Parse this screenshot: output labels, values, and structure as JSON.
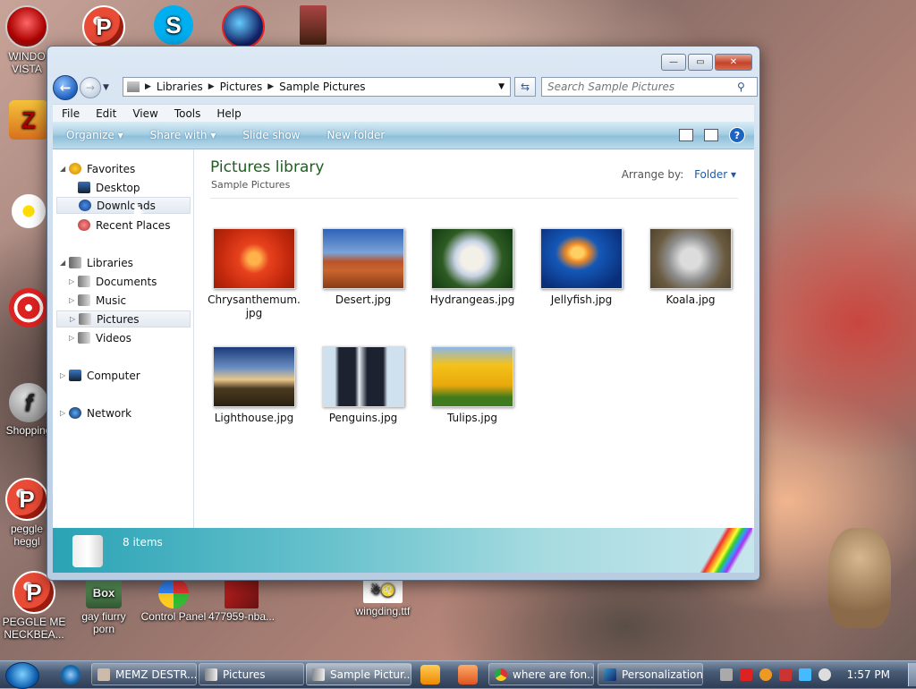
{
  "desktop": {
    "icons": [
      {
        "label": "WINDO\nVISTA",
        "name": "windows-vista"
      },
      {
        "label": "Shopping",
        "name": "shopping"
      },
      {
        "label": "peggle\nheggl",
        "name": "peggle-heggle"
      },
      {
        "label": "PEGGLE ME\nNECKBEA...",
        "name": "peggle-me"
      },
      {
        "label": "gay fiurry\nporn",
        "name": "box-shortcut"
      },
      {
        "label": "Control Panel",
        "name": "control-panel"
      },
      {
        "label": "477959-nba...",
        "name": "nba-image"
      },
      {
        "label": "wingding.ttf",
        "name": "wingding-font"
      }
    ]
  },
  "window": {
    "breadcrumb": [
      "Libraries",
      "Pictures",
      "Sample Pictures"
    ],
    "search_placeholder": "Search Sample Pictures",
    "menu": [
      "File",
      "Edit",
      "View",
      "Tools",
      "Help"
    ],
    "commands": [
      "Organize ▾",
      "Share with ▾",
      "Slide show",
      "New folder"
    ],
    "nav": {
      "favorites": "Favorites",
      "desktop": "Desktop",
      "downloads": "Downloads",
      "recent": "Recent Places",
      "libraries": "Libraries",
      "documents": "Documents",
      "music": "Music",
      "pictures": "Pictures",
      "videos": "Videos",
      "computer": "Computer",
      "network": "Network"
    },
    "content": {
      "title": "Pictures library",
      "subtitle": "Sample Pictures",
      "arrange_label": "Arrange by:",
      "arrange_value": "Folder ▾",
      "files": [
        {
          "line1": "Chrysanthemum.",
          "line2": "jpg"
        },
        {
          "line1": "Desert.jpg",
          "line2": ""
        },
        {
          "line1": "Hydrangeas.jpg",
          "line2": ""
        },
        {
          "line1": "Jellyfish.jpg",
          "line2": ""
        },
        {
          "line1": "Koala.jpg",
          "line2": ""
        },
        {
          "line1": "Lighthouse.jpg",
          "line2": ""
        },
        {
          "line1": "Penguins.jpg",
          "line2": ""
        },
        {
          "line1": "Tulips.jpg",
          "line2": ""
        }
      ]
    },
    "status": "8 items"
  },
  "taskbar": {
    "buttons": [
      {
        "label": "MEMZ DESTR...",
        "name": "memz"
      },
      {
        "label": "Pictures",
        "name": "pictures"
      },
      {
        "label": "Sample Pictur...",
        "name": "sample-pictures"
      },
      {
        "label": "where are fon...",
        "name": "chrome"
      },
      {
        "label": "Personalization",
        "name": "personalization"
      }
    ],
    "clock": "1:57 PM"
  },
  "colors": {
    "accent": "#1e5f1e",
    "link": "#1e5aa6"
  }
}
